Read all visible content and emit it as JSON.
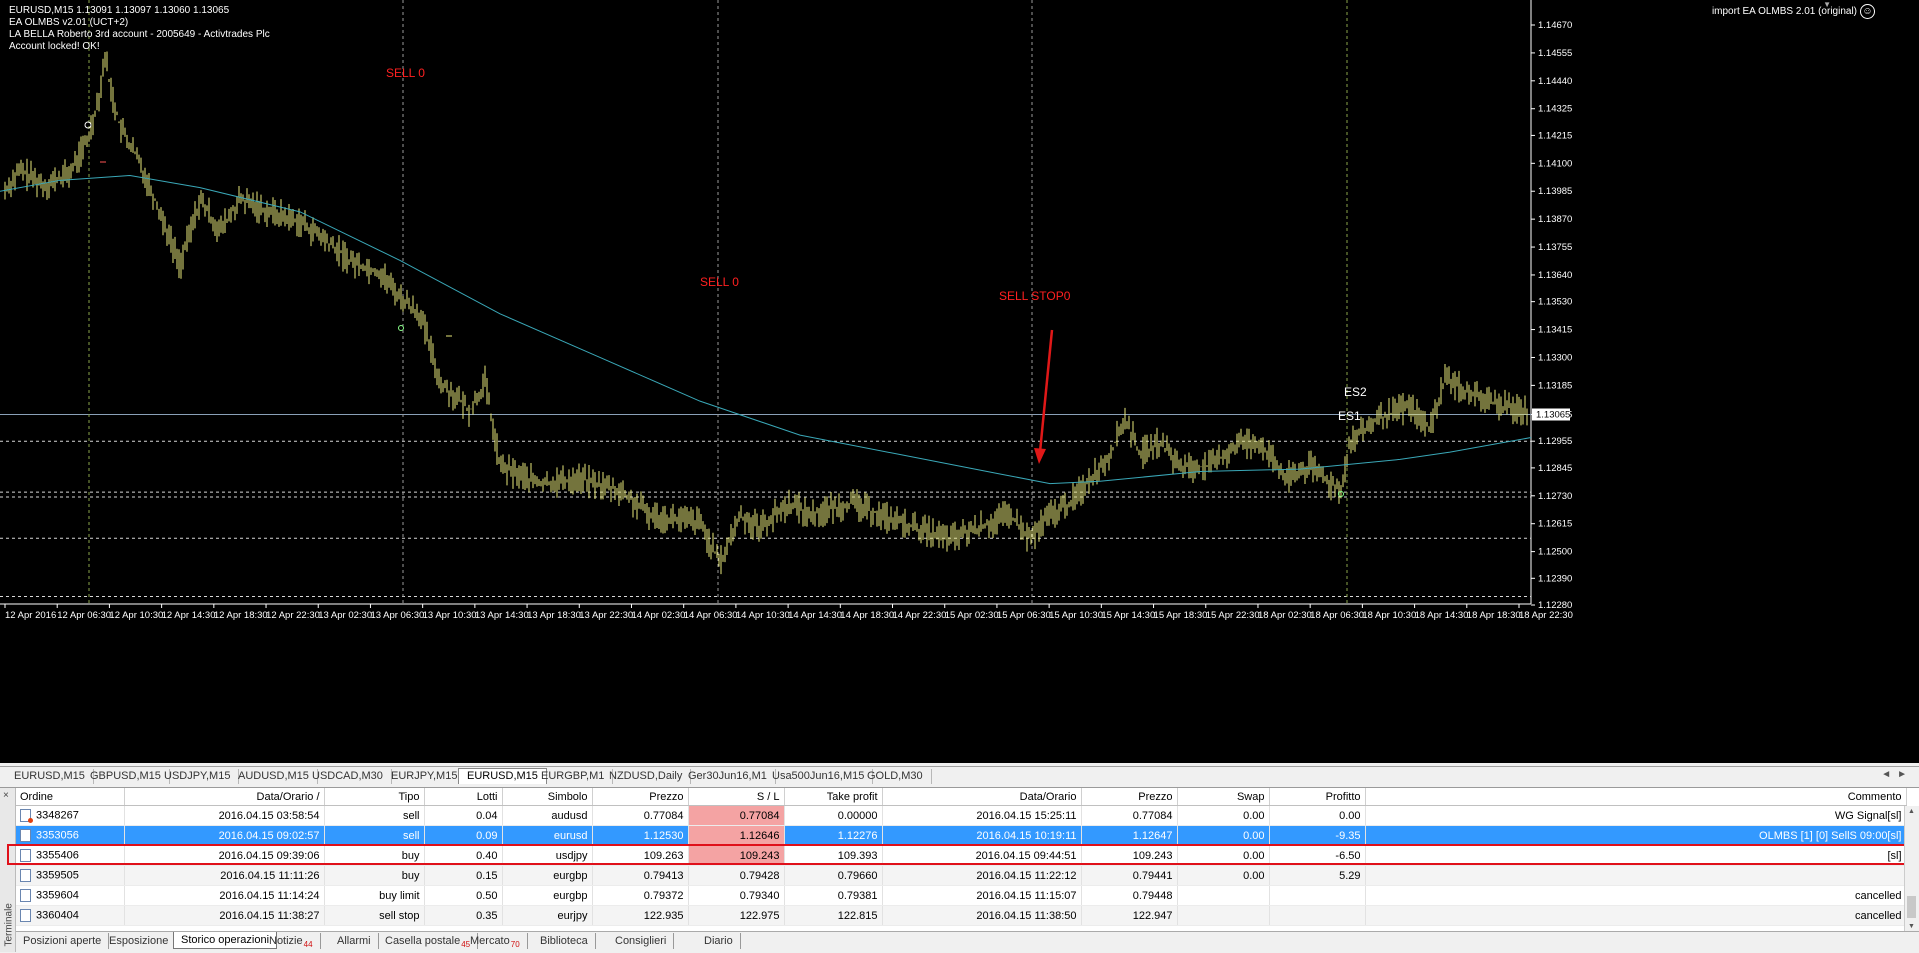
{
  "chart": {
    "info_lines": [
      "EURUSD,M15  1.13091 1.13097 1.13060 1.13065",
      "EA OLMBS v2.01 (UCT+2)",
      "LA BELLA  Roberto 3rd account - 2005649 - Activtrades Plc",
      "Account locked! OK!"
    ],
    "ea_label": "import EA OLMBS 2.01 (original)",
    "smiley": "☺",
    "price_ticks": [
      "1.14670",
      "1.14555",
      "1.14440",
      "1.14325",
      "1.14215",
      "1.14100",
      "1.13985",
      "1.13870",
      "1.13755",
      "1.13640",
      "1.13530",
      "1.13415",
      "1.13300",
      "1.13185",
      "1.13065",
      "1.12955",
      "1.12845",
      "1.12730",
      "1.12615",
      "1.12500",
      "1.12390",
      "1.12280"
    ],
    "current_price": "1.13065",
    "time_ticks": [
      "12 Apr 2016",
      "12 Apr 06:30",
      "12 Apr 10:30",
      "12 Apr 14:30",
      "12 Apr 18:30",
      "12 Apr 22:30",
      "13 Apr 02:30",
      "13 Apr 06:30",
      "13 Apr 10:30",
      "13 Apr 14:30",
      "13 Apr 18:30",
      "13 Apr 22:30",
      "14 Apr 02:30",
      "14 Apr 06:30",
      "14 Apr 10:30",
      "14 Apr 14:30",
      "14 Apr 18:30",
      "14 Apr 22:30",
      "15 Apr 02:30",
      "15 Apr 06:30",
      "15 Apr 10:30",
      "15 Apr 14:30",
      "15 Apr 18:30",
      "15 Apr 22:30",
      "18 Apr 02:30",
      "18 Apr 06:30",
      "18 Apr 10:30",
      "18 Apr 14:30",
      "18 Apr 18:30",
      "18 Apr 22:30"
    ],
    "annotations": {
      "sell_1": "SELL 0",
      "sell_2": "SELL 0",
      "sell_stop": "SELL STOP0",
      "es2": "ES2",
      "es1": "ES1"
    },
    "colors": {
      "bars": "#e8e87a",
      "ma": "#3aa8b8",
      "annotation": "#ff2020",
      "arrow": "#e01818"
    }
  },
  "chart_tabs": [
    "EURUSD,M15",
    "GBPUSD,M15",
    "USDJPY,M15",
    "AUDUSD,M15",
    "USDCAD,M30",
    "EURJPY,M15",
    "EURUSD,M15",
    "EURGBP,M1",
    "NZDUSD,Daily",
    "Ger30Jun16,M1",
    "Usa500Jun16,M15",
    "GOLD,M30"
  ],
  "chart_tabs_scroll": "◄►",
  "terminal": {
    "title": "Terminale",
    "close": "×",
    "columns": [
      "Ordine",
      "Data/Orario",
      "Tipo",
      "Lotti",
      "Simbolo",
      "Prezzo",
      "S / L",
      "Take profit",
      "Data/Orario",
      "Prezzo",
      "Swap",
      "Profitto",
      "Commento"
    ],
    "sort_indicator": "/",
    "rows": [
      [
        "3348267",
        "2016.04.15 03:58:54",
        "sell",
        "0.04",
        "audusd",
        "0.77084",
        "0.77084",
        "0.00000",
        "2016.04.15 15:25:11",
        "0.77084",
        "0.00",
        "0.00",
        "WG Signal[sl]"
      ],
      [
        "3353056",
        "2016.04.15 09:02:57",
        "sell",
        "0.09",
        "eurusd",
        "1.12530",
        "1.12646",
        "1.12276",
        "2016.04.15 10:19:11",
        "1.12647",
        "0.00",
        "-9.35",
        "OLMBS [1] [0] SellS 09:00[sl]"
      ],
      [
        "3355406",
        "2016.04.15 09:39:06",
        "buy",
        "0.40",
        "usdjpy",
        "109.263",
        "109.243",
        "109.393",
        "2016.04.15 09:44:51",
        "109.243",
        "0.00",
        "-6.50",
        "[sl]"
      ],
      [
        "3359505",
        "2016.04.15 11:11:26",
        "buy",
        "0.15",
        "eurgbp",
        "0.79413",
        "0.79428",
        "0.79660",
        "2016.04.15 11:22:12",
        "0.79441",
        "0.00",
        "5.29",
        ""
      ],
      [
        "3359604",
        "2016.04.15 11:14:24",
        "buy limit",
        "0.50",
        "eurgbp",
        "0.79372",
        "0.79340",
        "0.79381",
        "2016.04.15 11:15:07",
        "0.79448",
        "",
        "",
        "cancelled"
      ],
      [
        "3360404",
        "2016.04.15 11:38:27",
        "sell stop",
        "0.35",
        "eurjpy",
        "122.935",
        "122.975",
        "122.815",
        "2016.04.15 11:38:50",
        "122.947",
        "",
        "",
        "cancelled"
      ]
    ]
  },
  "terminal_tabs": [
    {
      "label": "Posizioni aperte",
      "badge": ""
    },
    {
      "label": "Esposizione",
      "badge": ""
    },
    {
      "label": "Storico operazioni",
      "badge": ""
    },
    {
      "label": "Notizie",
      "badge": "44"
    },
    {
      "label": "Allarmi",
      "badge": ""
    },
    {
      "label": "Casella postale",
      "badge": "45"
    },
    {
      "label": "Mercato",
      "badge": "70"
    },
    {
      "label": "Biblioteca",
      "badge": ""
    },
    {
      "label": "Consiglieri",
      "badge": ""
    },
    {
      "label": "Diario",
      "badge": ""
    }
  ]
}
